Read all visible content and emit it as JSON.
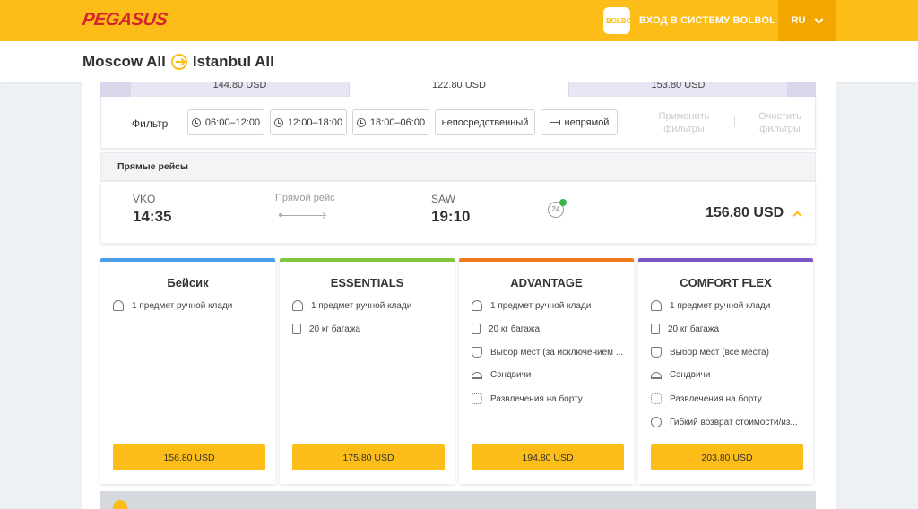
{
  "header": {
    "logo": "PEGASUS",
    "bolbol_badge": [
      "BOL",
      "BOL"
    ],
    "login_label": "ВХОД В СИСТЕМУ BOLBOL",
    "language": "RU",
    "colors": {
      "brand_yellow": "#fdbd19",
      "logo_red": "#d5262b"
    }
  },
  "route": {
    "from": "Moscow All",
    "to": "Istanbul All"
  },
  "date_strip": {
    "prices": [
      "144.80 USD",
      "122.80 USD",
      "153.80 USD"
    ]
  },
  "filters": {
    "label": "Фильтр",
    "options": [
      "06:00–12:00",
      "12:00–18:00",
      "18:00–06:00",
      "непосредственный",
      "непрямой"
    ],
    "apply": "Применить фильтры",
    "clear": "Очистить фильтры"
  },
  "direct_section_title": "Прямые рейсы",
  "flight": {
    "from_code": "VKO",
    "dep_time": "14:35",
    "type_label": "Прямой рейс",
    "to_code": "SAW",
    "arr_time": "19:10",
    "badge_24": "24",
    "price": "156.80 USD"
  },
  "fares": [
    {
      "name": "Бейсик",
      "color": "#4a9fe8",
      "features": [
        {
          "icon": "carry-on-bag-icon",
          "text": "1 предмет ручной клади"
        }
      ],
      "price": "156.80 USD"
    },
    {
      "name": "ESSENTIALS",
      "color": "#7fc63c",
      "features": [
        {
          "icon": "carry-on-bag-icon",
          "text": "1 предмет ручной клади"
        },
        {
          "icon": "suitcase-icon",
          "text": "20 кг багажа"
        }
      ],
      "price": "175.80 USD"
    },
    {
      "name": "ADVANTAGE",
      "color": "#f07a1a",
      "features": [
        {
          "icon": "carry-on-bag-icon",
          "text": "1 предмет ручной клади"
        },
        {
          "icon": "suitcase-icon",
          "text": "20 кг багажа"
        },
        {
          "icon": "seat-icon",
          "text": "Выбор мест (за исключением ..."
        },
        {
          "icon": "meal-icon",
          "text": "Сэндвичи"
        },
        {
          "icon": "entertainment-icon",
          "text": "Развлечения на борту"
        }
      ],
      "price": "194.80 USD"
    },
    {
      "name": "COMFORT FLEX",
      "color": "#7b55c4",
      "features": [
        {
          "icon": "carry-on-bag-icon",
          "text": "1 предмет ручной клади"
        },
        {
          "icon": "suitcase-icon",
          "text": "20 кг багажа"
        },
        {
          "icon": "seat-icon",
          "text": "Выбор мест (все места)"
        },
        {
          "icon": "meal-icon",
          "text": "Сэндвичи"
        },
        {
          "icon": "entertainment-icon",
          "text": "Развлечения на борту"
        },
        {
          "icon": "refund-icon",
          "text": "Гибкий возврат стоимости/из..."
        }
      ],
      "price": "203.80 USD"
    }
  ]
}
